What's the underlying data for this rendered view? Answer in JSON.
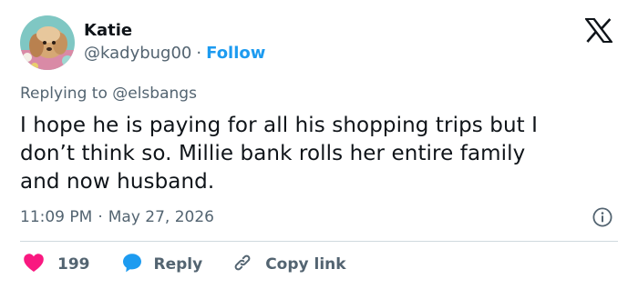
{
  "author": {
    "name": "Katie",
    "handle": "@kadybug00",
    "separator": "·",
    "follow_label": "Follow"
  },
  "reply_context": {
    "prefix": "Replying to",
    "mention": "@elsbangs"
  },
  "tweet": {
    "lines": [
      "I hope he is paying for all his shopping trips but I",
      "don’t think so. Millie bank rolls her entire family",
      "and now husband."
    ],
    "time": "11:09 PM",
    "separator": "·",
    "date": "May 27, 2026"
  },
  "actions": {
    "like_count": "199",
    "reply_label": "Reply",
    "copy_link_label": "Copy link"
  },
  "icons": {
    "logo": "x-logo-icon",
    "info": "info-icon",
    "like": "heart-icon",
    "reply": "speech-bubble-icon",
    "copy": "link-icon"
  },
  "colors": {
    "text": "#0f1419",
    "secondary": "#536471",
    "accent": "#1d9bf0",
    "like": "#f91880",
    "divider": "#cfd9de"
  }
}
